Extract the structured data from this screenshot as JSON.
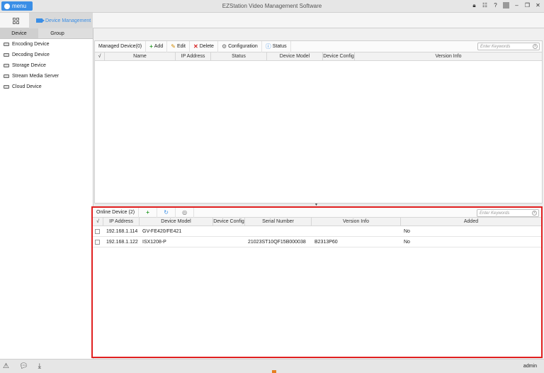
{
  "app": {
    "menu_label": "menu",
    "title": "EZStation Video Management Software"
  },
  "tabs": {
    "device_management": "Device Management"
  },
  "left_panel": {
    "tabs": [
      "Device",
      "Group"
    ],
    "items": [
      "Encoding Device",
      "Decoding Device",
      "Storage Device",
      "Stream Media Server",
      "Cloud Device"
    ]
  },
  "managed": {
    "title": "Managed Device(0)",
    "actions": {
      "add": "Add",
      "edit": "Edit",
      "delete": "Delete",
      "configuration": "Configuration",
      "status": "Status"
    },
    "search_placeholder": "Enter Keywords",
    "columns": [
      "√",
      "Name",
      "IP Address",
      "Status",
      "Device Model",
      "Device Config",
      "Version Info"
    ]
  },
  "online": {
    "title": "Online Device (2)",
    "search_placeholder": "Enter Keywords",
    "columns": [
      "√",
      "IP Address",
      "Device Model",
      "Device Config",
      "Serial Number",
      "Version Info",
      "Added"
    ],
    "rows": [
      {
        "ip": "192.168.1.114",
        "model": "GV-FE420/FE421",
        "config": "",
        "serial": "",
        "version": "",
        "added": "No"
      },
      {
        "ip": "192.168.1.122",
        "model": "ISX1208-P",
        "config": "",
        "serial": "21023ST10QF15B000038",
        "version": "B2313P60",
        "added": "No"
      }
    ]
  },
  "status_bar": {
    "user": "admin"
  },
  "colors": {
    "accent": "#3a8ee6",
    "highlight_border": "#e02020"
  }
}
